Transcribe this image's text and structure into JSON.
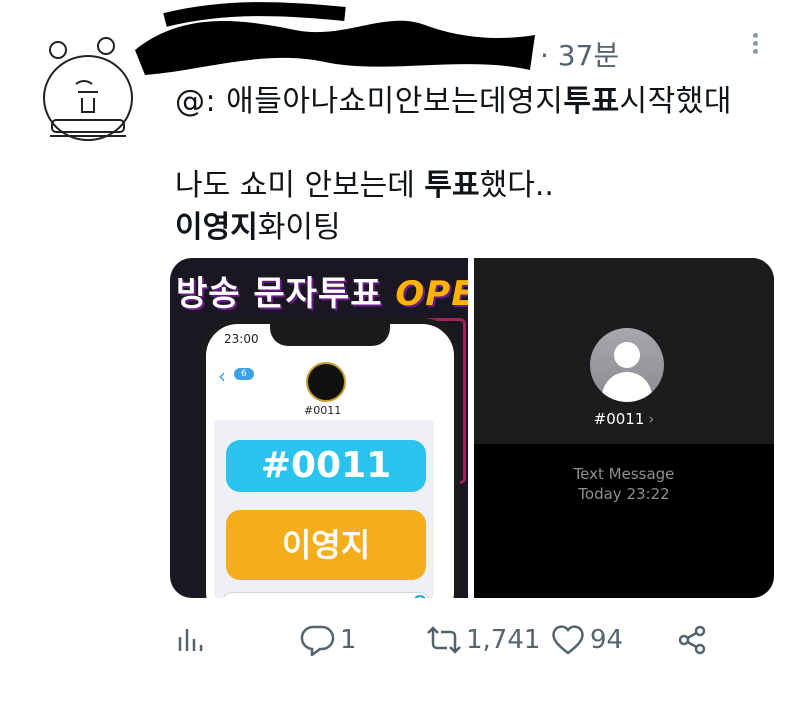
{
  "tweet": {
    "timestamp": "· 37분",
    "reply_to_line": "@: 애들아나쇼미안보는데영지투표시작했대",
    "reply_to_parts": [
      "@: 애들아나쇼미안보는데영지",
      "투표",
      "시작했대"
    ],
    "body_line1_parts": [
      "나도 쇼미 안보는데 ",
      "투표",
      "했다.."
    ],
    "body_line2_parts": [
      "이영지",
      "화이팅"
    ]
  },
  "media": {
    "left": {
      "banner_text": "방송 문자투표",
      "banner_accent": "OPE",
      "phone_time": "23:00",
      "phone_back_badge": "6",
      "contact_label": "#0011",
      "bubble_code": "#0011",
      "bubble_name": "이영지"
    },
    "right": {
      "contact_number": "#0011",
      "chevron": "›",
      "message_type": "Text Message",
      "message_time": "Today 23:22"
    }
  },
  "actions": {
    "replies": "1",
    "retweets": "1,741",
    "likes": "94"
  },
  "icons": {
    "analytics": "analytics-icon",
    "reply": "reply-icon",
    "retweet": "retweet-icon",
    "like": "heart-icon",
    "share": "share-icon",
    "more": "more-icon"
  },
  "colors": {
    "secondary_text": "#536471",
    "bubble_blue": "#29c3ee",
    "bubble_orange": "#f6ad1b"
  }
}
